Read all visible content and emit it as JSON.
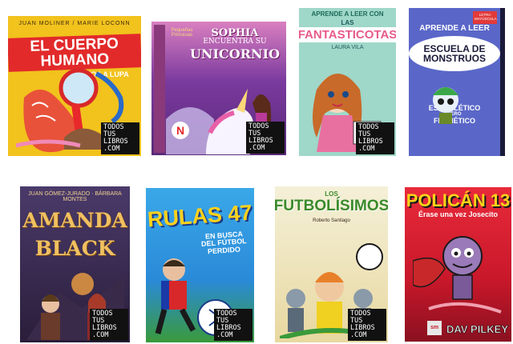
{
  "watermark": {
    "line1": "TODOS",
    "line2": "TUS",
    "line3": "LIBROS",
    "line4": ".COM"
  },
  "colors": {
    "watermark_bg": "#111111",
    "watermark_text": "#ffffff",
    "page_bg": "#ffffff"
  },
  "books": [
    {
      "authors": "JUAN MOLINER / MARIE LOCONN",
      "title": "EL CUERPO HUMANO",
      "subtitle": "BAJO LA LUPA"
    },
    {
      "brand": "Pequeñas Princesas",
      "title_line1": "SOPHIA",
      "title_line2": "ENCUENTRA SU",
      "title_line3": "UNICORNIO",
      "badge": "N"
    },
    {
      "header": "APRENDE A LEER CON",
      "title_top": "LAS",
      "title": "FANTASTICOTAS",
      "author": "LAURA VILA"
    },
    {
      "badge": "LETRA MAYÚSCULA",
      "header": "APRENDE A LEER",
      "title": "ESCUELA DE MONSTRUOS",
      "subtitle_line1": "ESQUELÉTICO",
      "subtitle_line2": "PERO",
      "subtitle_line3": "FRENÉTICO"
    },
    {
      "authors": "JUAN GÓMEZ-JURADO · BÁRBARA MONTES",
      "title_line1": "AMANDA",
      "title_line2": "BLACK"
    },
    {
      "title": "RULAS 47",
      "subtitle_line1": "EN BUSCA",
      "subtitle_line2": "DEL FÚTBOL",
      "subtitle_line3": "PERDIDO"
    },
    {
      "title_top": "LOS",
      "title": "FUTBOLÍSIMOS",
      "author": "Roberto Santiago"
    },
    {
      "title": "POLICÁN 13",
      "subtitle": "Érase una vez Josecito",
      "author": "DAV PILKEY",
      "publisher": "sm"
    }
  ]
}
